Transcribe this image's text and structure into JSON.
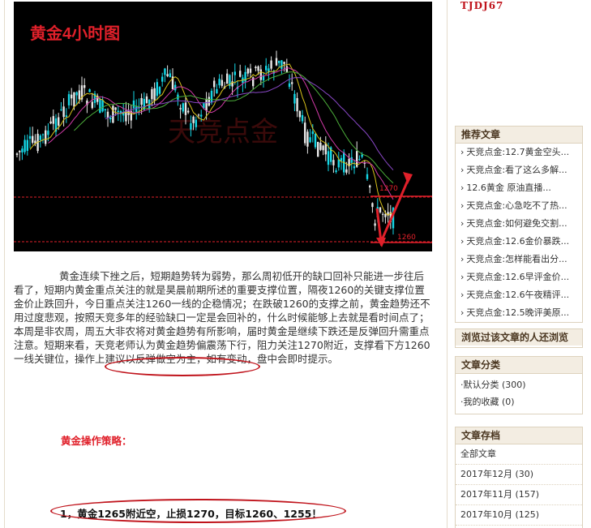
{
  "chart": {
    "title": "黄金4小时图",
    "watermark": "天竞点金",
    "level_high": "1270",
    "level_low": "1260",
    "colors": {
      "background": "#000000",
      "title": "#e0202a",
      "up_candle": "#14d7e6",
      "down_candle": "#e8e8e8",
      "ma_yellow": "#d9c21a",
      "ma_pink": "#d23aa8",
      "ma_green": "#4cae3a",
      "ma_purple": "#8a48c8",
      "level_line": "#e0202a"
    }
  },
  "article": {
    "paragraph": "黄金连续下挫之后，短期趋势转为弱势，那么周初低开的缺口回补只能进一步往后看了，短期内黄金重点关注的就是昊晨前期所述的重要支撑位置，隔夜1260的关键支撑位置金价止跌回升，今日重点关注1260一线的企稳情况；在跌破1260的支撑之前，黄金趋势还不用过度悲观，按照天竞多年的经验缺口一定是会回补的，什么时候能够上去就是看时间点了；本周是非农周，周五大非农将对黄金趋势有所影响，届时黄金是继续下跌还是反弹回升需重点注意。短期来看，天竞老师认为黄金趋势偏震荡下行，阻力关注1270附近，支撑看下方1260一线关键位，操作上建议以反弹做空为主，如有变动，盘中会即时提示。",
    "strategy_title": "黄金操作策略：",
    "strategy_line": "1，黄金1265附近空，止损1270，目标1260、1255！"
  },
  "sidebar": {
    "user_id": "TJDJ67",
    "recommended": {
      "title": "推荐文章",
      "items": [
        "天竞点金:12.7黄金空头...",
        "天竞点金:看了这么多解...",
        "12.6黄金 原油直播...",
        "天竞点金:心急吃不了热...",
        "天竞点金:如何避免交割...",
        "天竞点金:12.6金价暴跌...",
        "天竞点金:怎样能看出分...",
        "天竞点金:12.6早评金价...",
        "天竞点金:12.6午夜精评...",
        "天竞点金:12.5晚评美原..."
      ]
    },
    "also_viewed": {
      "title": "浏览过该文章的人还浏览"
    },
    "categories": {
      "title": "文章分类",
      "items": [
        "默认分类 (300)",
        "我的收藏 (0)"
      ]
    },
    "archive": {
      "title": "文章存档",
      "items": [
        "全部文章",
        "2017年12月 (30)",
        "2017年11月 (157)",
        "2017年10月 (125)"
      ]
    }
  }
}
